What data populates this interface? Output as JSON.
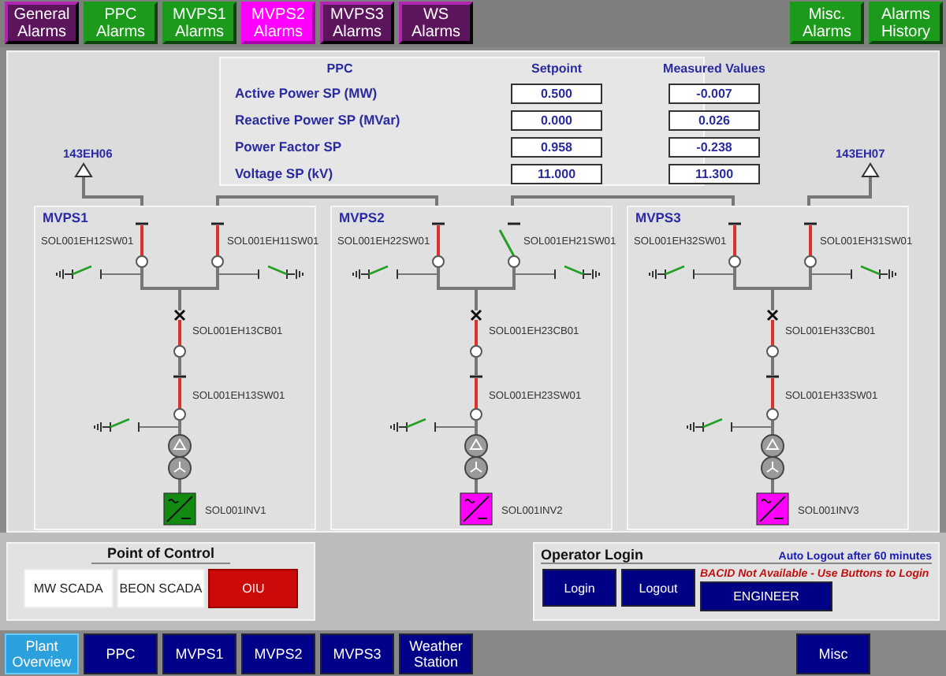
{
  "alarm_nav": [
    {
      "label": "General\nAlarms",
      "color": "#5c145c"
    },
    {
      "label": "PPC\nAlarms",
      "color": "#1c9a1c"
    },
    {
      "label": "MVPS1\nAlarms",
      "color": "#1c9a1c"
    },
    {
      "label": "MVPS2\nAlarms",
      "color": "#ff00ff"
    },
    {
      "label": "MVPS3\nAlarms",
      "color": "#5c145c"
    },
    {
      "label": "WS\nAlarms",
      "color": "#5c145c"
    }
  ],
  "alarm_nav_right": [
    {
      "label": "Misc.\nAlarms",
      "color": "#1c9a1c"
    },
    {
      "label": "Alarms\nHistory",
      "color": "#1c9a1c"
    }
  ],
  "ppc": {
    "title": "PPC",
    "columns": [
      "Setpoint",
      "Measured Values"
    ],
    "rows": [
      {
        "label": "Active Power SP (MW)",
        "setpoint": "0.500",
        "measured": "-0.007"
      },
      {
        "label": "Reactive Power SP (MVar)",
        "setpoint": "0.000",
        "measured": "0.026"
      },
      {
        "label": "Power Factor SP",
        "setpoint": "0.958",
        "measured": "-0.238"
      },
      {
        "label": "Voltage SP (kV)",
        "setpoint": "11.000",
        "measured": "11.300"
      }
    ]
  },
  "feeders": [
    {
      "label": "143EH06"
    },
    {
      "label": "143EH07"
    }
  ],
  "stations": [
    {
      "title": "MVPS1",
      "left_switch": {
        "label": "SOL001EH12SW01",
        "closed": true
      },
      "right_switch": {
        "label": "SOL001EH11SW01",
        "closed": true
      },
      "left_earth": {
        "closed": false
      },
      "right_earth": {
        "closed": false
      },
      "breaker": {
        "label": "SOL001EH13CB01",
        "closed": true
      },
      "lower_switch": {
        "label": "SOL001EH13SW01",
        "closed": true
      },
      "lower_earth": {
        "closed": false
      },
      "inverter": {
        "label": "SOL001INV1",
        "color": "#128a12"
      }
    },
    {
      "title": "MVPS2",
      "left_switch": {
        "label": "SOL001EH22SW01",
        "closed": true
      },
      "right_switch": {
        "label": "SOL001EH21SW01",
        "closed": false
      },
      "left_earth": {
        "closed": false
      },
      "right_earth": {
        "closed": false
      },
      "breaker": {
        "label": "SOL001EH23CB01",
        "closed": true
      },
      "lower_switch": {
        "label": "SOL001EH23SW01",
        "closed": true
      },
      "lower_earth": {
        "closed": false
      },
      "inverter": {
        "label": "SOL001INV2",
        "color": "#ff00ff"
      }
    },
    {
      "title": "MVPS3",
      "left_switch": {
        "label": "SOL001EH32SW01",
        "closed": true
      },
      "right_switch": {
        "label": "SOL001EH31SW01",
        "closed": true
      },
      "left_earth": {
        "closed": false
      },
      "right_earth": {
        "closed": false
      },
      "breaker": {
        "label": "SOL001EH33CB01",
        "closed": true
      },
      "lower_switch": {
        "label": "SOL001EH33SW01",
        "closed": true
      },
      "lower_earth": {
        "closed": false
      },
      "inverter": {
        "label": "SOL001INV3",
        "color": "#ff00ff"
      }
    }
  ],
  "point_of_control": {
    "title": "Point of Control",
    "options": [
      {
        "label": "MW SCADA",
        "selected": false
      },
      {
        "label": "BEON SCADA",
        "selected": false
      },
      {
        "label": "OIU",
        "selected": true
      }
    ]
  },
  "operator_login": {
    "title": "Operator Login",
    "notice": "Auto Logout after 60 minutes",
    "warning": "BACID Not Available - Use Buttons to Login",
    "buttons": [
      "Login",
      "Logout"
    ],
    "user": "ENGINEER"
  },
  "screen_nav": [
    {
      "label": "Plant\nOverview",
      "selected": true
    },
    {
      "label": "PPC",
      "selected": false
    },
    {
      "label": "MVPS1",
      "selected": false
    },
    {
      "label": "MVPS2",
      "selected": false
    },
    {
      "label": "MVPS3",
      "selected": false
    },
    {
      "label": "Weather\nStation",
      "selected": false
    }
  ],
  "screen_nav_right": [
    {
      "label": "Misc",
      "selected": false
    }
  ]
}
